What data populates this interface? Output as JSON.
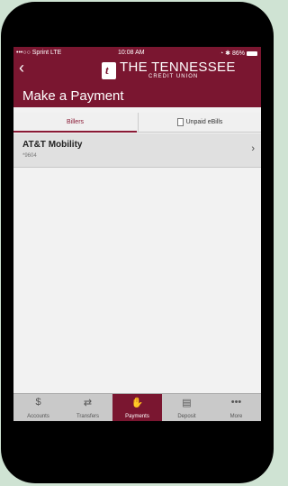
{
  "status_bar": {
    "carrier": "•••○○ Sprint  LTE",
    "time": "10:08 AM",
    "battery": "86%"
  },
  "header": {
    "brand_name": "THE TENNESSEE",
    "brand_sub": "CREDIT UNION",
    "page_title": "Make a Payment",
    "brand_color": "#7a1630"
  },
  "tabs": [
    {
      "label": "Billers",
      "active": true
    },
    {
      "label": "Unpaid eBills",
      "active": false
    }
  ],
  "billers": [
    {
      "name": "AT&T Mobility",
      "account": "*9604"
    }
  ],
  "tabbar": [
    {
      "label": "Accounts",
      "icon": "dollar-icon",
      "active": false
    },
    {
      "label": "Transfers",
      "icon": "transfer-icon",
      "active": false
    },
    {
      "label": "Payments",
      "icon": "payments-icon",
      "active": true
    },
    {
      "label": "Deposit",
      "icon": "check-deposit-icon",
      "active": false
    },
    {
      "label": "More",
      "icon": "more-dots-icon",
      "active": false
    }
  ]
}
